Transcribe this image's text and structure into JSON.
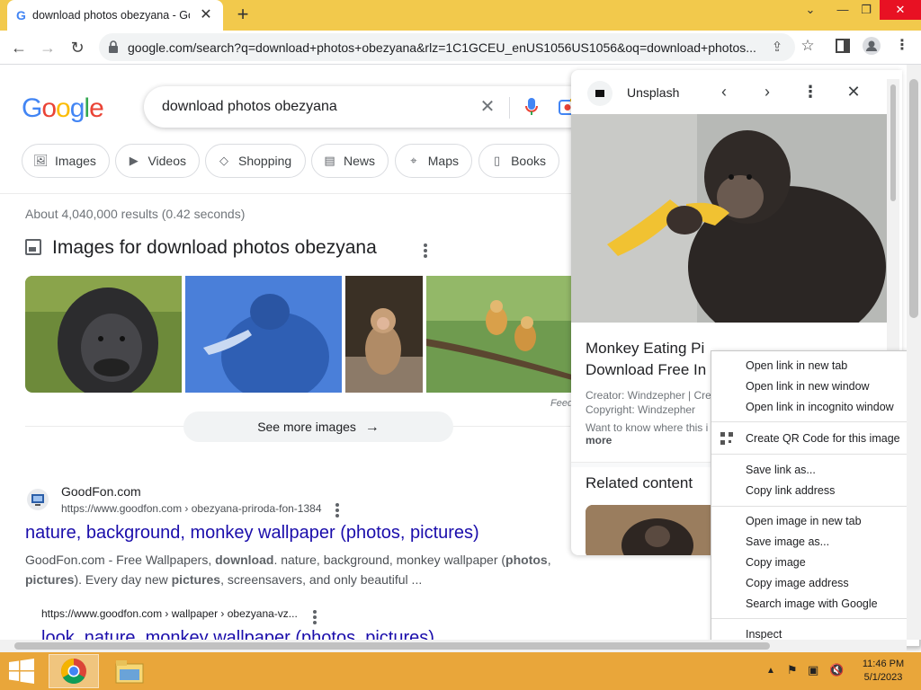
{
  "browser": {
    "tab_title": "download photos obezyana - Google Search",
    "tab_favicon": "G",
    "url": "google.com/search?q=download+photos+obezyana&rlz=1C1GCEU_enUS1056US1056&oq=download+photos..."
  },
  "search": {
    "logo": [
      "G",
      "o",
      "o",
      "g",
      "l",
      "e"
    ],
    "logo_colors": [
      "#4285f4",
      "#ea4335",
      "#fbbc05",
      "#4285f4",
      "#34a853",
      "#ea4335"
    ],
    "query": "download photos obezyana"
  },
  "chips": [
    {
      "label": "Images",
      "icon": "image-icon"
    },
    {
      "label": "Videos",
      "icon": "play-icon"
    },
    {
      "label": "Shopping",
      "icon": "tag-icon"
    },
    {
      "label": "News",
      "icon": "news-icon"
    },
    {
      "label": "Maps",
      "icon": "map-pin-icon"
    },
    {
      "label": "Books",
      "icon": "book-icon"
    }
  ],
  "results": {
    "stats": "About 4,040,000 results (0.42 seconds)",
    "images_heading": "Images for download photos obezyana",
    "see_more": "See more images",
    "feedback": "Feed",
    "first": {
      "site": "GoodFon.com",
      "url": "https://www.goodfon.com › obezyana-priroda-fon-1384",
      "title": "nature, background, monkey wallpaper (photos, pictures)",
      "snippet_parts": [
        {
          "t": "GoodFon.com - Free Wallpapers, ",
          "b": false
        },
        {
          "t": "download",
          "b": true
        },
        {
          "t": ". nature, background, monkey wallpaper (",
          "b": false
        },
        {
          "t": "photos",
          "b": true
        },
        {
          "t": ", ",
          "b": false
        },
        {
          "t": "pictures",
          "b": true
        },
        {
          "t": "). Every day new ",
          "b": false
        },
        {
          "t": "pictures",
          "b": true
        },
        {
          "t": ", screensavers, and only beautiful ...",
          "b": false
        }
      ]
    },
    "second": {
      "url": "https://www.goodfon.com › wallpaper › obezyana-vz...",
      "title": "look, nature, monkey wallpaper (photos, pictures)"
    }
  },
  "panel": {
    "source": "Unsplash",
    "title_line1": "Monkey Eating Pi",
    "title_line2": "Download Free In",
    "creator": "Creator: Windzepher | Cre",
    "copyright": "Copyright: Windzepher",
    "want": "Want to know where this i",
    "more": "more",
    "related": "Related content"
  },
  "context_menu": {
    "group1": [
      "Open link in new tab",
      "Open link in new window",
      "Open link in incognito window"
    ],
    "qr": "Create QR Code for this image",
    "group2": [
      "Save link as...",
      "Copy link address"
    ],
    "group3": [
      "Open image in new tab",
      "Save image as...",
      "Copy image",
      "Copy image address",
      "Search image with Google"
    ],
    "inspect": "Inspect"
  },
  "taskbar": {
    "time": "11:46 PM",
    "date": "5/1/2023"
  }
}
